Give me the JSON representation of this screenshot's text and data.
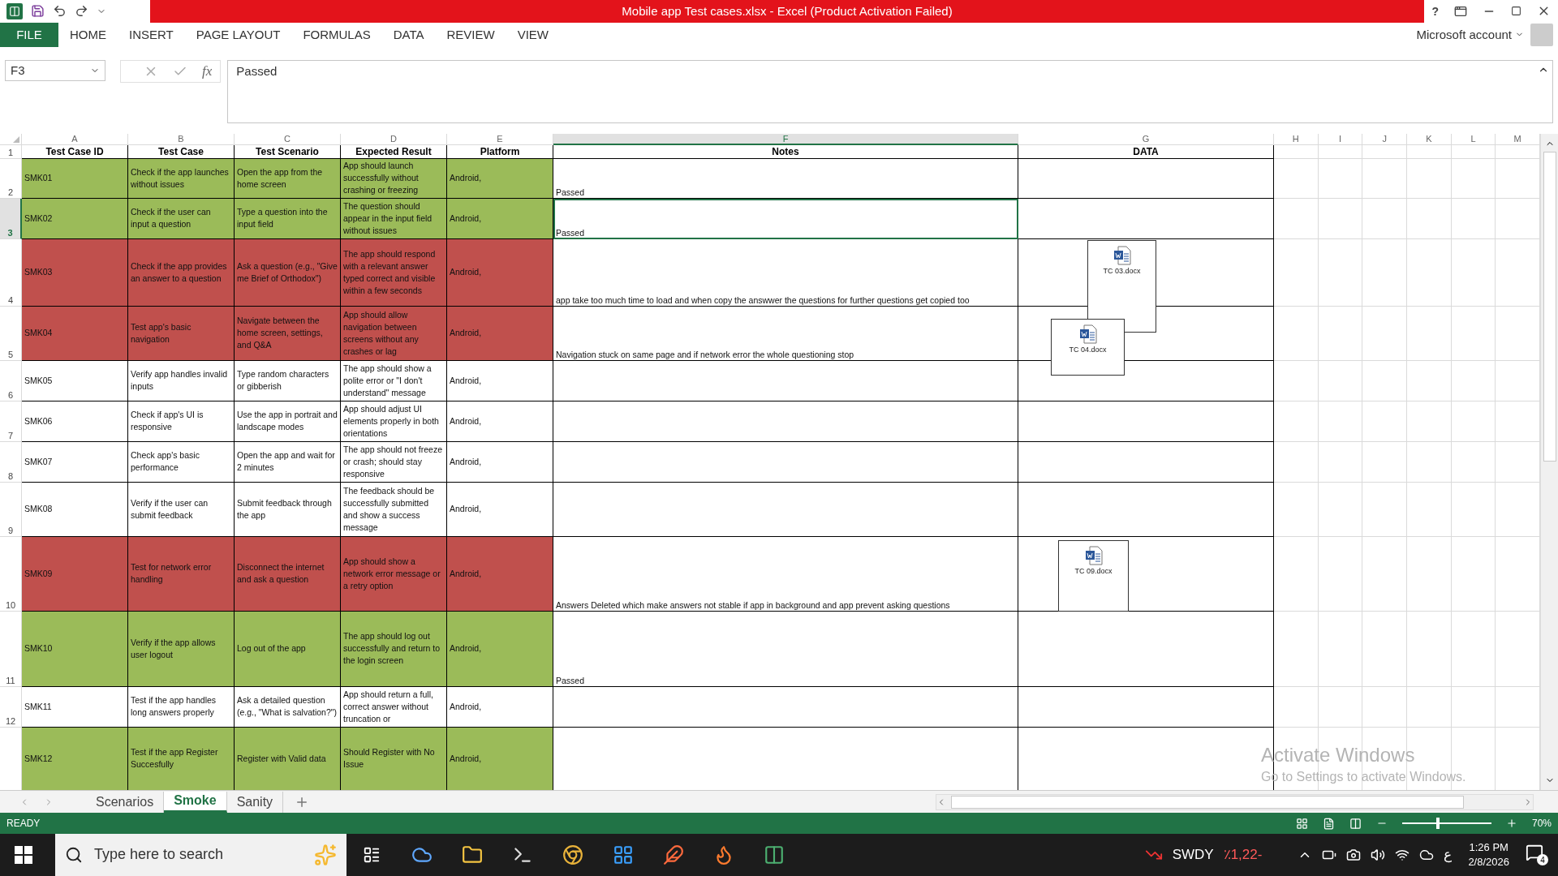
{
  "window": {
    "title": "Mobile app Test cases.xlsx -  Excel (Product Activation Failed)",
    "help": "?"
  },
  "ribbon": {
    "tabs": [
      {
        "label": "FILE",
        "kind": "file"
      },
      {
        "label": "HOME",
        "kind": "tab"
      },
      {
        "label": "INSERT",
        "kind": "tab"
      },
      {
        "label": "PAGE LAYOUT",
        "kind": "tab"
      },
      {
        "label": "FORMULAS",
        "kind": "tab"
      },
      {
        "label": "DATA",
        "kind": "tab"
      },
      {
        "label": "REVIEW",
        "kind": "tab"
      },
      {
        "label": "VIEW",
        "kind": "tab"
      }
    ],
    "account": "Microsoft account"
  },
  "formula_bar": {
    "name_box": "F3",
    "function_label": "fx",
    "value": "Passed"
  },
  "sheet": {
    "columns": [
      {
        "label": "A",
        "selected": false
      },
      {
        "label": "B",
        "selected": false
      },
      {
        "label": "C",
        "selected": false
      },
      {
        "label": "D",
        "selected": false
      },
      {
        "label": "E",
        "selected": false
      },
      {
        "label": "F",
        "selected": true
      },
      {
        "label": "G",
        "selected": false
      },
      {
        "label": "H",
        "selected": false
      },
      {
        "label": "I",
        "selected": false
      },
      {
        "label": "J",
        "selected": false
      },
      {
        "label": "K",
        "selected": false
      },
      {
        "label": "L",
        "selected": false
      },
      {
        "label": "M",
        "selected": false
      }
    ],
    "header_row": {
      "number": "1",
      "cells": [
        "Test Case ID",
        "Test Case",
        "Test Scenario",
        "Expected Result",
        "Platform",
        "Notes",
        "DATA"
      ]
    },
    "rows": [
      {
        "number": "2",
        "selected": false,
        "color": "#9bbb59",
        "id": "SMK01",
        "test_case": "Check if the app launches without issues",
        "scenario": "Open the app from the home screen",
        "expected": "App should launch successfully without crashing or freezing",
        "platform": "Android,",
        "notes": "Passed"
      },
      {
        "number": "3",
        "selected": true,
        "color": "#9bbb59",
        "id": "SMK02",
        "test_case": "Check if the user can input a question",
        "scenario": "Type a question into the input field",
        "expected": "The question should appear in the input field without issues",
        "platform": "Android,",
        "notes": "Passed"
      },
      {
        "number": "4",
        "selected": false,
        "color": "#c0504d",
        "id": "SMK03",
        "test_case": "Check if the app provides an answer to a question",
        "scenario": "Ask a question (e.g., \"Give me Brief of Orthodox\")",
        "expected": "The app should respond with a relevant answer typed correct and visible within a few seconds",
        "platform": "Android,",
        "notes": "app take too much time to load and when copy the answwer the questions for further questions get copied too"
      },
      {
        "number": "5",
        "selected": false,
        "color": "#c0504d",
        "id": "SMK04",
        "test_case": "Test app's basic navigation",
        "scenario": "Navigate between the home screen, settings, and Q&A",
        "expected": "App should allow navigation between screens without any crashes or lag",
        "platform": "Android,",
        "notes": "Navigation stuck on same page and if network error the whole questioning stop"
      },
      {
        "number": "6",
        "selected": false,
        "color": "#ffffff",
        "id": "SMK05",
        "test_case": "Verify app handles invalid inputs",
        "scenario": "Type random characters or gibberish",
        "expected": "The app should show a polite error or \"I don't understand\" message",
        "platform": "Android,"
      },
      {
        "number": "7",
        "selected": false,
        "color": "#ffffff",
        "id": "SMK06",
        "test_case": "Check if app's UI is responsive",
        "scenario": "Use the app in portrait and landscape modes",
        "expected": "App should adjust UI elements properly in both orientations",
        "platform": "Android,"
      },
      {
        "number": "8",
        "selected": false,
        "color": "#ffffff",
        "id": "SMK07",
        "test_case": "Check app's basic performance",
        "scenario": "Open the app and wait for 2 minutes",
        "expected": "The app should not freeze or crash; should stay responsive",
        "platform": "Android,"
      },
      {
        "number": "9",
        "selected": false,
        "color": "#ffffff",
        "id": "SMK08",
        "test_case": "Verify if the user can submit feedback",
        "scenario": "Submit feedback through the app",
        "expected": "The feedback should be successfully submitted and show a success message",
        "platform": "Android,"
      },
      {
        "number": "10",
        "selected": false,
        "color": "#c0504d",
        "id": "SMK09",
        "test_case": "Test for network error handling",
        "scenario": "Disconnect the internet and ask a question",
        "expected": "App should show a network error message or a retry option",
        "platform": "Android,",
        "notes": "Answers Deleted which make answers not stable if app in background and app prevent asking questions"
      },
      {
        "number": "11",
        "selected": false,
        "color": "#9bbb59",
        "id": "SMK10",
        "test_case": "Verify if the app allows user logout",
        "scenario": "Log out of the app",
        "expected": "The app should log out successfully and return to the login screen",
        "platform": "Android,",
        "notes": "Passed"
      },
      {
        "number": "12",
        "selected": false,
        "color": "#ffffff",
        "id": "SMK11",
        "test_case": "Test if the app handles long answers properly",
        "scenario": "Ask a detailed question (e.g., \"What is salvation?\")",
        "expected": "App should return a full, correct answer without truncation or",
        "platform": "Android,"
      },
      {
        "selected": false,
        "color": "#9bbb59",
        "id": "SMK12",
        "test_case": "Test if the app Register Succesfully",
        "scenario": "Register with Valid data",
        "expected": "Should Register with No Issue",
        "platform": "Android,"
      }
    ],
    "attachments": [
      {
        "label": "TC 03.docx"
      },
      {
        "label": "TC 04.docx"
      },
      {
        "label": "TC 09.docx"
      }
    ]
  },
  "sheet_tabs": [
    {
      "label": "Scenarios",
      "selected": false
    },
    {
      "label": "Smoke",
      "selected": true
    },
    {
      "label": "Sanity",
      "selected": false
    }
  ],
  "status_bar": {
    "status": "READY",
    "zoom": "70%",
    "zoom_slider": {
      "level": 0.38
    }
  },
  "activation": {
    "title": "Activate Windows",
    "hint": "Go to Settings to activate Windows."
  },
  "taskbar": {
    "search_placeholder": "Type here to search",
    "ticker": "SWDY",
    "ticker_change": "٪1,22-",
    "language": "ع",
    "time": "1:26 PM",
    "date": "2/8/2026",
    "notifications": "4"
  }
}
